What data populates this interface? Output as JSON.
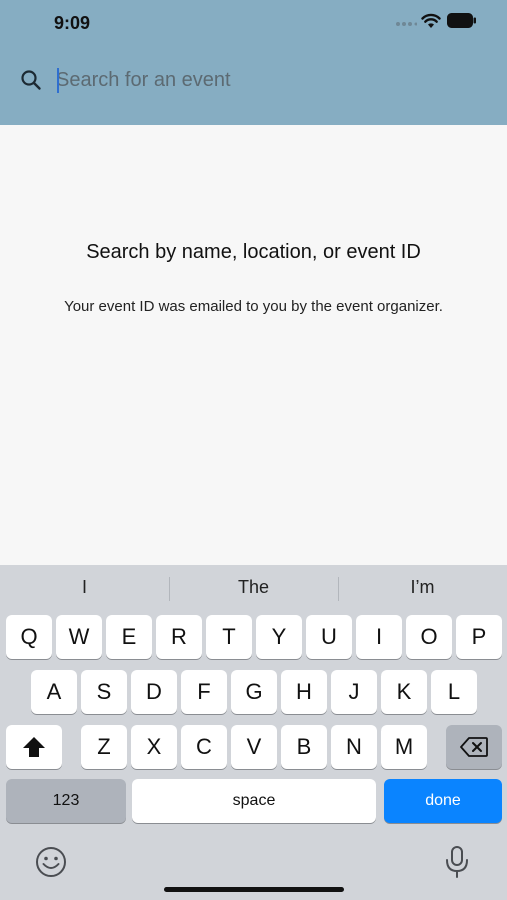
{
  "status_bar": {
    "time": "9:09"
  },
  "search": {
    "placeholder": "Search for an event",
    "value": ""
  },
  "empty_state": {
    "title": "Search by name, location, or event ID",
    "subtitle": "Your event ID was emailed to you by the event organizer."
  },
  "keyboard": {
    "suggestions": [
      "I",
      "The",
      "I’m"
    ],
    "row1": [
      "Q",
      "W",
      "E",
      "R",
      "T",
      "Y",
      "U",
      "I",
      "O",
      "P"
    ],
    "row2": [
      "A",
      "S",
      "D",
      "F",
      "G",
      "H",
      "J",
      "K",
      "L"
    ],
    "row3": [
      "Z",
      "X",
      "C",
      "V",
      "B",
      "N",
      "M"
    ],
    "numbers_label": "123",
    "space_label": "space",
    "done_label": "done"
  },
  "colors": {
    "header": "#86adc2",
    "background": "#f7f7f7",
    "keyboard": "#d1d4d9",
    "done_key": "#0a84ff"
  },
  "icons": [
    "search-icon",
    "wifi-icon",
    "battery-icon",
    "shift-icon",
    "delete-icon",
    "emoji-icon",
    "microphone-icon"
  ]
}
